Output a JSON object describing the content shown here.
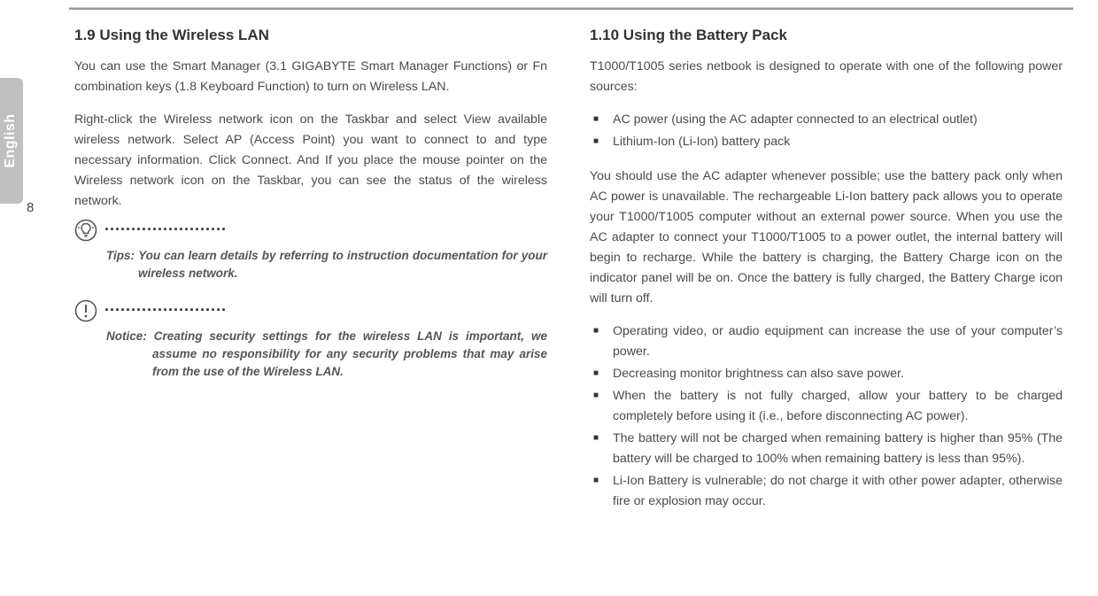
{
  "sideTab": {
    "language": "English"
  },
  "pageNumber": "8",
  "left": {
    "heading": "1.9   Using the Wireless LAN",
    "para1": "You can use the Smart Manager (3.1 GIGABYTE Smart Manager Functions) or Fn combination keys (1.8 Keyboard Function) to turn on Wireless LAN.",
    "para2": "Right-click the Wireless network icon on the Taskbar and select View available wireless network. Select AP (Access Point) you want to connect to and type necessary information. Click Connect. And If you place the mouse pointer on the Wireless network icon on the Taskbar, you can see the status of the wireless network.",
    "tip": {
      "dots": ".......................",
      "label": "Tips: ",
      "text": "You can learn details by referring to instruction documentation for your wireless network."
    },
    "notice": {
      "dots": ".......................",
      "label": "Notice: ",
      "text": "Creating security settings for the wireless LAN is important, we assume no responsibility for any security problems that may arise from the use of the Wireless LAN."
    }
  },
  "right": {
    "heading": "1.10   Using the Battery Pack",
    "para1": "T1000/T1005 series netbook is designed to operate with one of the following power sources:",
    "list1": {
      "0": "AC power (using the AC adapter connected to an electrical outlet)",
      "1": "Lithium-Ion (Li-Ion) battery pack"
    },
    "para2": "You should use the AC adapter whenever possible; use the battery pack only when AC power is unavailable. The rechargeable Li-Ion battery pack allows you to operate your T1000/T1005 computer without an external power source. When you use the AC adapter to connect your T1000/T1005 to a power outlet, the internal battery will begin to recharge. While the battery is charging, the Battery Charge icon on the indicator panel will be on. Once the battery is fully charged, the Battery Charge icon will turn off.",
    "list2": {
      "0": "Operating video, or audio equipment can increase the use of your computer’s power.",
      "1": "Decreasing monitor brightness can also save power.",
      "2": "When the battery is not fully charged, allow your battery to be charged completely before using it (i.e., before disconnecting AC power).",
      "3": "The battery will not be charged when remaining battery is higher than 95% (The battery will be charged to 100% when remaining battery is less than 95%).",
      "4": "Li-Ion Battery is vulnerable; do not charge it with other power adapter, otherwise fire or explosion may occur."
    }
  }
}
